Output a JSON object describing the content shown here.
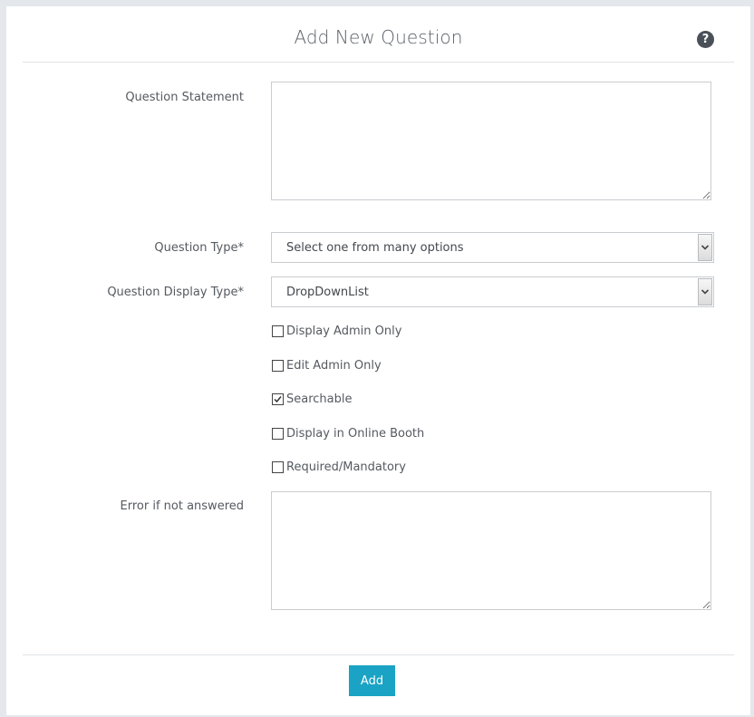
{
  "header": {
    "title": "Add New Question",
    "help_glyph": "?"
  },
  "form": {
    "question_statement": {
      "label": "Question Statement",
      "value": ""
    },
    "question_type": {
      "label": "Question Type*",
      "value": "Select one from many options"
    },
    "question_display_type": {
      "label": "Question Display Type*",
      "value": "DropDownList"
    },
    "checkboxes": [
      {
        "label": "Display Admin Only",
        "checked": false
      },
      {
        "label": "Edit Admin Only",
        "checked": false
      },
      {
        "label": "Searchable",
        "checked": true
      },
      {
        "label": "Display in Online Booth",
        "checked": false
      },
      {
        "label": "Required/Mandatory",
        "checked": false
      }
    ],
    "error_if_not_answered": {
      "label": "Error if not answered",
      "value": ""
    }
  },
  "footer": {
    "add_label": "Add"
  },
  "colors": {
    "accent": "#1aa3c4",
    "background": "#e4e7ec",
    "panel": "#ffffff",
    "text": "#555a60"
  },
  "icons": {
    "help": "question-circle-icon",
    "select_arrow": "chevron-down-icon",
    "checkmark": "checkmark-icon"
  }
}
